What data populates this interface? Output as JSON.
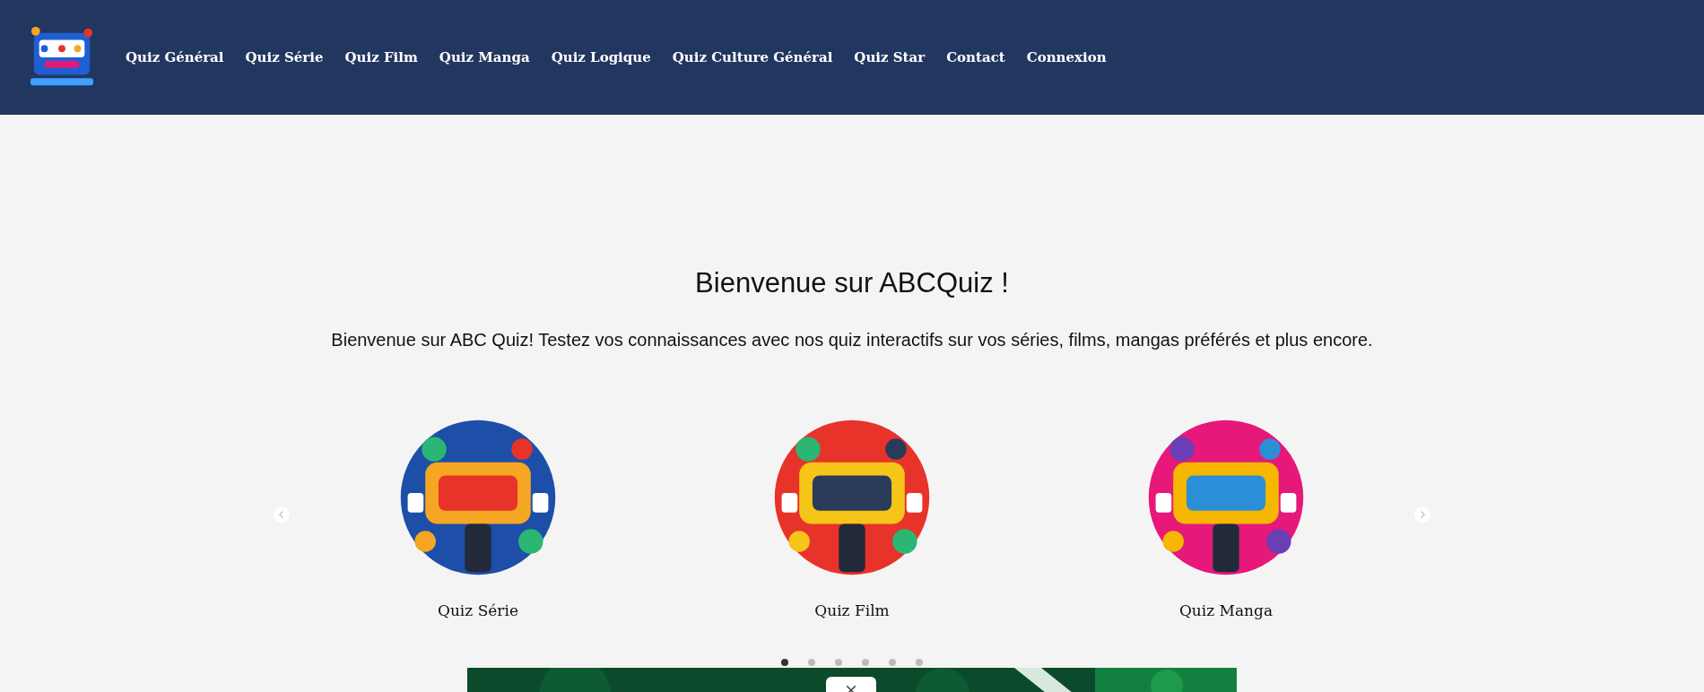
{
  "nav": {
    "items": [
      {
        "label": "Quiz Général"
      },
      {
        "label": "Quiz Série"
      },
      {
        "label": "Quiz Film"
      },
      {
        "label": "Quiz Manga"
      },
      {
        "label": "Quiz Logique"
      },
      {
        "label": "Quiz Culture Général"
      },
      {
        "label": "Quiz Star"
      },
      {
        "label": "Contact"
      },
      {
        "label": "Connexion"
      }
    ]
  },
  "heading": "Bienvenue sur ABCQuiz !",
  "intro": "Bienvenue sur ABC Quiz! Testez vos connaissances avec nos quiz interactifs sur vos séries, films, mangas préférés et plus encore.",
  "carousel": {
    "slides": [
      {
        "caption": "Quiz Série",
        "kind": "picture"
      },
      {
        "caption": "Quiz Film",
        "kind": "picture"
      },
      {
        "caption": "Quiz Manga",
        "kind": "picture"
      }
    ],
    "dots": [
      {
        "selected": true
      },
      {
        "selected": false
      },
      {
        "selected": false
      },
      {
        "selected": false
      },
      {
        "selected": false
      },
      {
        "selected": false
      }
    ]
  }
}
